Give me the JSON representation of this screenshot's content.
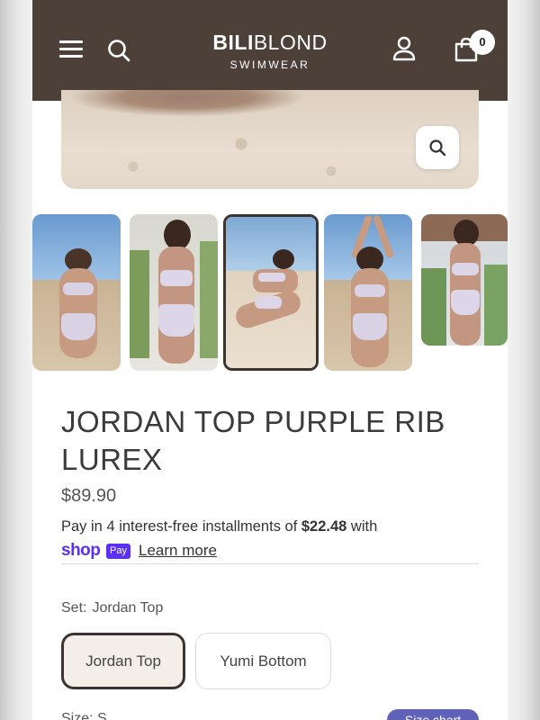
{
  "header": {
    "logo_bold": "BILI",
    "logo_light": "BLOND",
    "logo_sub": "SWIMWEAR",
    "cart_count": "0"
  },
  "product": {
    "title": "JORDAN TOP PURPLE RIB LUREX",
    "price": "$89.90",
    "installment_prefix": "Pay in 4 interest-free installments of ",
    "installment_amount": "$22.48",
    "installment_suffix": " with",
    "shop_word": "shop",
    "pay_word": "Pay",
    "learn_more": "Learn more"
  },
  "set": {
    "label": "Set:",
    "value": "Jordan Top",
    "options": [
      {
        "label": "Jordan Top",
        "selected": true
      },
      {
        "label": "Yumi Bottom",
        "selected": false
      }
    ]
  },
  "size": {
    "label": "Size:",
    "value": "S",
    "chart_button": "Size chart"
  },
  "gallery": {
    "thumbnail_count": 5,
    "active_index": 2
  },
  "colors": {
    "header_bg": "#4d4038",
    "shop_pay": "#5a31f4",
    "size_chart_bg": "#5f62b8",
    "selected_option_bg": "#f3efe8",
    "selected_border": "#3d3430"
  }
}
